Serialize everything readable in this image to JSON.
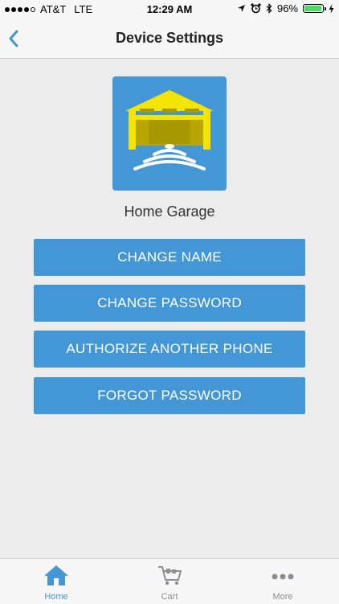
{
  "status_bar": {
    "carrier": "AT&T",
    "network": "LTE",
    "time": "12:29 AM",
    "battery_percent": "96%",
    "battery_level": 0.96
  },
  "nav": {
    "title": "Device Settings",
    "back_icon": "chevron-left-icon"
  },
  "device": {
    "name": "Home Garage",
    "icon": "garage-wifi-icon"
  },
  "actions": {
    "change_name": "CHANGE NAME",
    "change_password": "CHANGE PASSWORD",
    "authorize_phone": "AUTHORIZE ANOTHER PHONE",
    "forgot_password": "FORGOT PASSWORD"
  },
  "tabs": [
    {
      "label": "Home",
      "icon": "home-icon",
      "active": true
    },
    {
      "label": "Cart",
      "icon": "cart-icon",
      "active": false
    },
    {
      "label": "More",
      "icon": "more-icon",
      "active": false
    }
  ],
  "colors": {
    "accent": "#4397d6",
    "garage_yellow": "#f5e400",
    "background": "#ececec"
  }
}
